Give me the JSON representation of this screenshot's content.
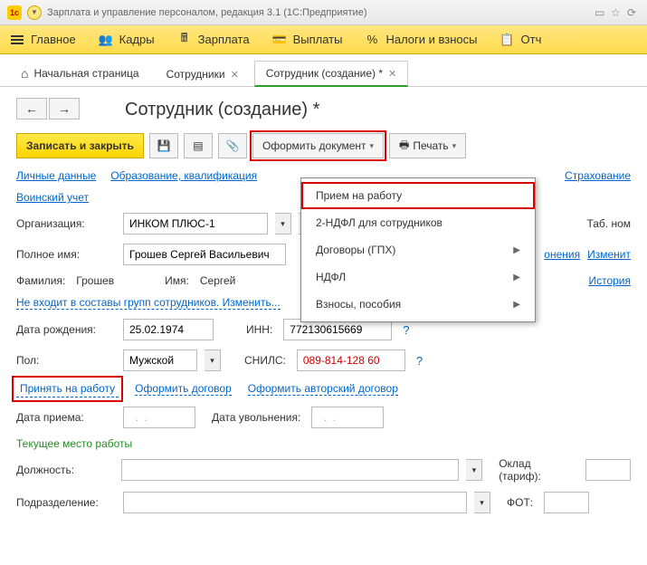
{
  "titlebar": {
    "title": "Зарплата и управление персоналом, редакция 3.1  (1С:Предприятие)"
  },
  "mainmenu": {
    "home": "Главное",
    "kadry": "Кадры",
    "zarplata": "Зарплата",
    "vyplaty": "Выплаты",
    "nalogi": "Налоги и взносы",
    "otch": "Отч"
  },
  "tabs": {
    "home": "Начальная страница",
    "employees": "Сотрудники",
    "employee_create": "Сотрудник (создание) *"
  },
  "page": {
    "title": "Сотрудник (создание) *"
  },
  "toolbar": {
    "save_close": "Записать и закрыть",
    "oformit": "Оформить документ",
    "print": "Печать"
  },
  "dropdown": {
    "hire": "Прием на работу",
    "ndfl2": "2-НДФЛ для сотрудников",
    "contracts": "Договоры (ГПХ)",
    "ndfl": "НДФЛ",
    "vznosy": "Взносы, пособия"
  },
  "tabs2": {
    "personal": "Личные данные",
    "education": "Образование, квалификация",
    "insurance": "Страхование",
    "military": "Воинский учет"
  },
  "form": {
    "org_label": "Организация:",
    "org_value": "ИНКОМ ПЛЮС-1",
    "tabno_label": "Таб. ном",
    "fullname_label": "Полное имя:",
    "fullname_value": "Грошев Сергей Васильевич",
    "clarify": "онения",
    "change": "Изменит",
    "surname_label": "Фамилия:",
    "surname_value": "Грошев",
    "name_label": "Имя:",
    "name_value": "Сергей",
    "history": "История",
    "not_in_groups": "Не входит в составы групп сотрудников. Изменить...",
    "birthdate_label": "Дата рождения:",
    "birthdate_value": "25.02.1974",
    "inn_label": "ИНН:",
    "inn_value": "772130615669",
    "gender_label": "Пол:",
    "gender_value": "Мужской",
    "snils_label": "СНИЛС:",
    "snils_value": "089-814-128 60",
    "hire_link": "Принять на работу",
    "contract_link": "Оформить договор",
    "author_contract_link": "Оформить авторский договор",
    "hire_date_label": "Дата приема:",
    "fire_date_label": "Дата увольнения:",
    "date_placeholder": "  .  .    ",
    "current_place": "Текущее место работы",
    "position_label": "Должность:",
    "oklad_label": "Оклад (тариф):",
    "department_label": "Подразделение:",
    "fot_label": "ФОТ:"
  }
}
